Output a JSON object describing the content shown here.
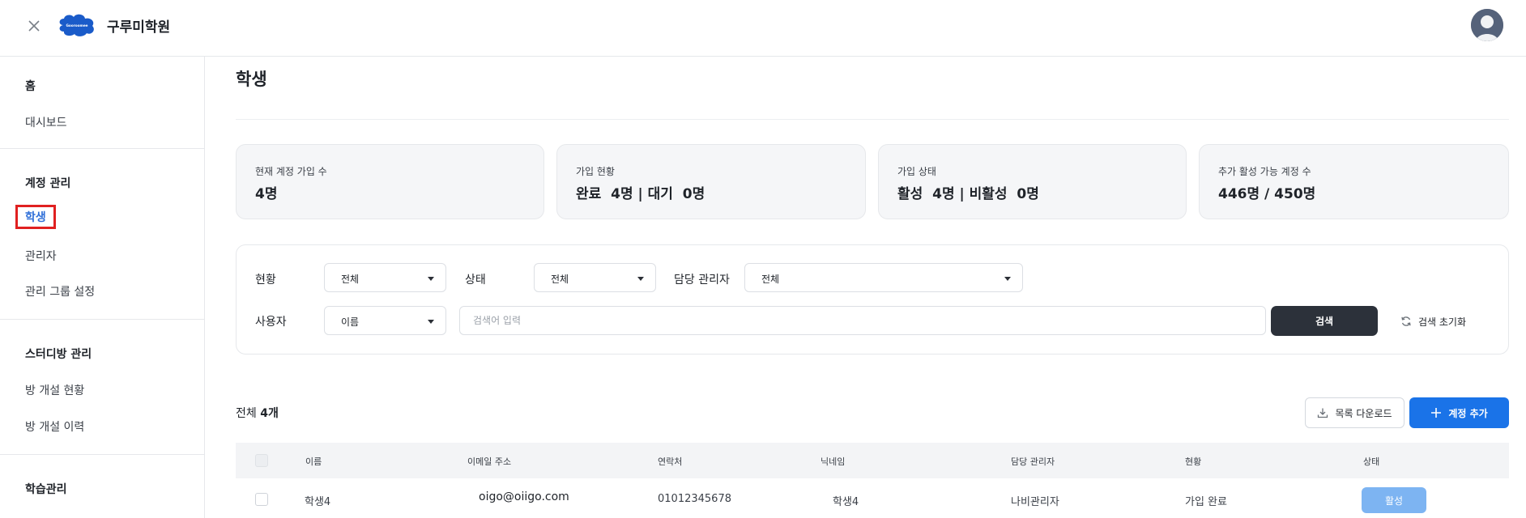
{
  "topbar": {
    "title": "구루미학원",
    "logo_text": "Gooroomee",
    "icons": {
      "close": "close-icon",
      "avatar": "user-avatar"
    }
  },
  "sidebar": {
    "sections": [
      {
        "heading": "홈",
        "items": [
          "대시보드"
        ]
      },
      {
        "heading": "계정 관리",
        "items": [
          "학생",
          "관리자",
          "관리 그룹 설정"
        ]
      },
      {
        "heading": "스터디방 관리",
        "items": [
          "방 개설 현황",
          "방 개설 이력"
        ]
      },
      {
        "heading": "학습관리",
        "items": []
      }
    ],
    "active_item": "학생"
  },
  "main": {
    "title": "학생",
    "stats": [
      {
        "label": "현재 계정 가입 수",
        "value": "4명"
      },
      {
        "label": "가입 현황",
        "value": "완료  4명 | 대기  0명"
      },
      {
        "label": "가입 상태",
        "value": "활성  4명 | 비활성  0명"
      },
      {
        "label": "추가 활성 가능 계정 수",
        "value": "446명 / 450명"
      }
    ],
    "filters": {
      "status_label": "현황",
      "status_value": "전체",
      "state_label": "상태",
      "state_value": "전체",
      "manager_label": "담당 관리자",
      "manager_value": "전체",
      "user_label": "사용자",
      "user_field_value": "이름",
      "search_placeholder": "검색어 입력",
      "search_button": "검색",
      "reset_button": "검색 초기화"
    },
    "list": {
      "total_prefix": "전체",
      "total_count": "4개",
      "download_button": "목록 다운로드",
      "add_button": "계정 추가",
      "columns": [
        "이름",
        "이메일 주소",
        "연락처",
        "닉네임",
        "담당 관리자",
        "현황",
        "상태"
      ],
      "rows": [
        {
          "name": "학생4",
          "email": "oigo@oiigo.com",
          "phone": "01012345678",
          "nickname": "학생4",
          "manager": "나비관리자",
          "status": "가입 완료",
          "state": "활성"
        }
      ]
    }
  },
  "colors": {
    "accent": "#1a73e8",
    "dark_button": "#2c313a",
    "active_highlight": "#e02020",
    "badge": "#7db4f2"
  }
}
